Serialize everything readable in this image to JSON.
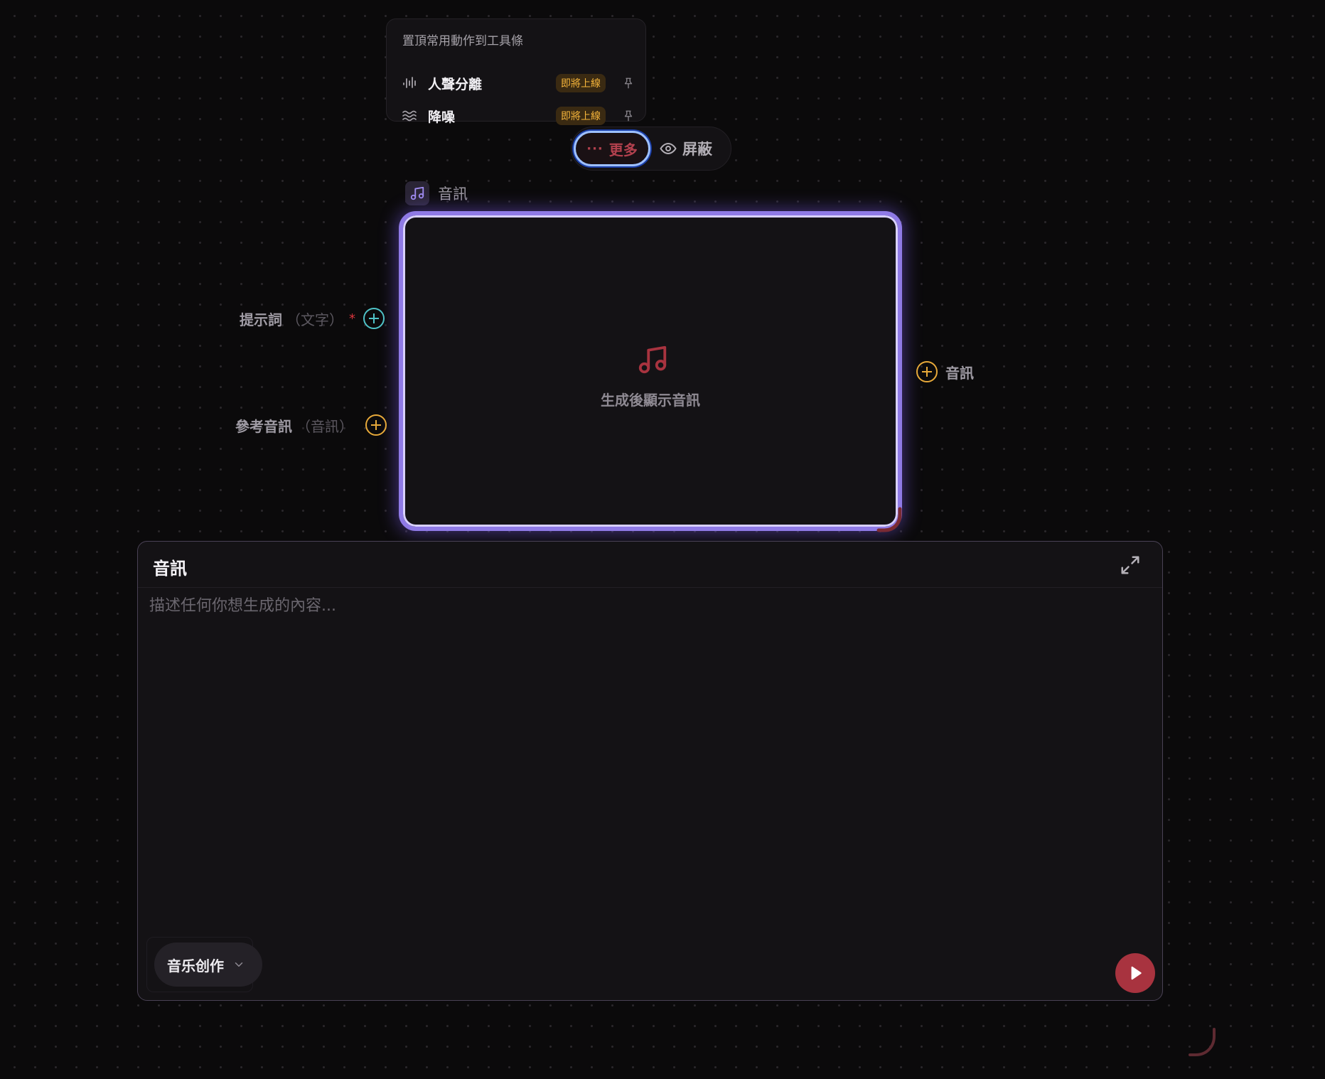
{
  "pin_popup": {
    "title": "置頂常用動作到工具條",
    "items": [
      {
        "icon": "waveform-icon",
        "label": "人聲分離",
        "badge": "即將上線",
        "pin_icon": "pin-icon"
      },
      {
        "icon": "noise-wave-icon",
        "label": "降噪",
        "badge": "即將上線",
        "pin_icon": "pin-icon"
      }
    ]
  },
  "action_bar": {
    "more_label": "更多",
    "more_icon": "ellipsis-icon",
    "hide_label": "屏蔽",
    "hide_icon": "eye-icon"
  },
  "node": {
    "icon": "music-note-icon",
    "title": "音訊",
    "placeholder_icon": "music-note-icon",
    "placeholder_text": "生成後顯示音訊"
  },
  "ports": {
    "inputs": [
      {
        "label": "提示詞",
        "type": "（文字）",
        "required": true,
        "required_mark": "*",
        "color": "#4fc3c8"
      },
      {
        "label": "參考音訊",
        "type": "（音訊）",
        "required": false,
        "color": "#e7a93a"
      }
    ],
    "output": {
      "label": "音訊",
      "color": "#e7a93a"
    }
  },
  "prompt_panel": {
    "title": "音訊",
    "expand_icon": "expand-icon",
    "input_value": "",
    "input_placeholder": "描述任何你想生成的內容...",
    "mode_selected": "音乐创作",
    "mode_icon": "chevron-down-icon",
    "run_icon": "play-icon"
  },
  "colors": {
    "background": "#0b0a0b",
    "node_border": "#8f7ae6",
    "accent_red": "#a8333f",
    "badge_text": "#f6b53b"
  }
}
